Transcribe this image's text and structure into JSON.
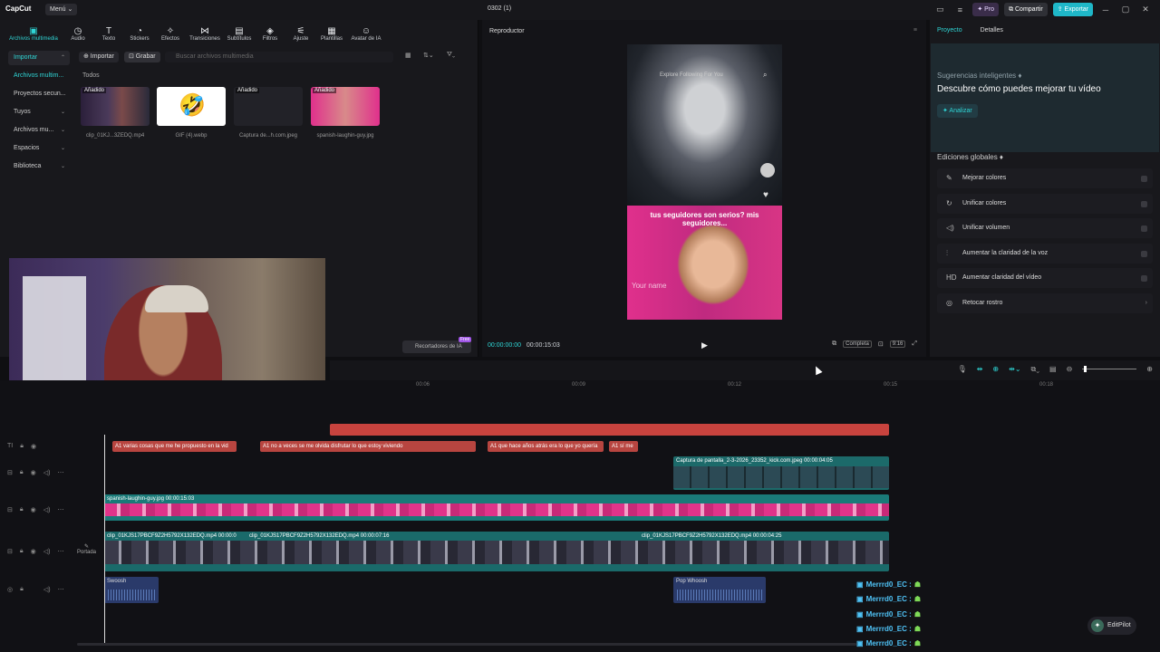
{
  "app": {
    "logo": "CapCut",
    "menu": "Menú ⌄",
    "project_title": "0302 (1)"
  },
  "topbar": {
    "pro": "✦ Pro",
    "share": "⧉ Compartir",
    "export": "⇪ Exportar",
    "min": "─",
    "max": "▢",
    "close": "✕"
  },
  "tools": [
    {
      "label": "Archivos multimedia",
      "icon": "▣"
    },
    {
      "label": "Audio",
      "icon": "◷"
    },
    {
      "label": "Texto",
      "icon": "T"
    },
    {
      "label": "Stickers",
      "icon": "◔"
    },
    {
      "label": "Efectos",
      "icon": "✧"
    },
    {
      "label": "Transiciones",
      "icon": "⋈"
    },
    {
      "label": "Subtítulos",
      "icon": "▤"
    },
    {
      "label": "Filtros",
      "icon": "◈"
    },
    {
      "label": "Ajuste",
      "icon": "⚟"
    },
    {
      "label": "Plantillas",
      "icon": "▦"
    },
    {
      "label": "Avatar de IA",
      "icon": "☺"
    }
  ],
  "sidenav": [
    {
      "label": "Importar"
    },
    {
      "label": "Archivos multim..."
    },
    {
      "label": "Proyectos secun..."
    },
    {
      "label": "Tuyos"
    },
    {
      "label": "Archivos mu..."
    },
    {
      "label": "Espacios"
    },
    {
      "label": "Biblioteca"
    }
  ],
  "media": {
    "import": "⊕ Importar",
    "record": "⊡ Grabar",
    "search_placeholder": "Buscar archivos multimedia",
    "filter": "Todos",
    "items": [
      {
        "tag": "Añadido",
        "name": "clip_01KJ...3ZEDQ.mp4"
      },
      {
        "tag": "",
        "name": "GIF (4).webp"
      },
      {
        "tag": "Añadido",
        "name": "Captura de...h.com.jpeg"
      },
      {
        "tag": "Añadido",
        "name": "spanish-laughin-guy.jpg"
      }
    ],
    "ai_cutouts": "Recortadores de IA",
    "free": "Free"
  },
  "player": {
    "title": "Reproductor",
    "current_time": "00:00:00:00",
    "total_time": "00:00:15:03",
    "full": "Completa",
    "ratio": "9:16",
    "video_nav": "Explore   Following   For You",
    "video_caption": "tus seguidores son serios? mis seguidores...",
    "video_overlay": "Your name"
  },
  "right": {
    "tab_project": "Proyecto",
    "tab_details": "Detalles",
    "suggest_sub": "Sugerencias inteligentes ♦",
    "suggest_main": "Descubre cómo puedes mejorar tu vídeo",
    "analyze": "✦ Analizar",
    "global_title": "Ediciones globales ♦",
    "edits": [
      {
        "label": "Mejorar colores",
        "icon": "✎"
      },
      {
        "label": "Unificar colores",
        "icon": "↻"
      },
      {
        "label": "Unificar volumen",
        "icon": "◁)"
      },
      {
        "label": "Aumentar la claridad de la voz",
        "icon": "⫶"
      },
      {
        "label": "Aumentar claridad del vídeo",
        "icon": "HD"
      },
      {
        "label": "Retocar rostro",
        "icon": "◎"
      }
    ]
  },
  "timeline": {
    "ruler": [
      "00:06",
      "00:09",
      "00:12",
      "00:15",
      "00:18"
    ],
    "subs": [
      "A1 varias cosas que me he propuesto en la vid",
      "A1 no a veces se me olvida disfrutar lo que estoy viviendo",
      "A1 que hace años atrás era lo que yo quería",
      "A1 sí me"
    ],
    "screenshot_clip": "Captura de pantalla_2-3-2026_23352_kick.com.jpeg  00:00:04:05",
    "laugh_clip": "spanish-laughin-guy.jpg  00:00:15:03",
    "main_clips": [
      "clip_01KJS17PBCF9Z2H5792X132EDQ.mp4  00:00:0",
      "clip_01KJS17PBCF9Z2H5792X132EDQ.mp4  00:00:07:16",
      "clip_01KJS17PBCF9Z2H5792X132EDQ.mp4  00:00:04:25"
    ],
    "cover": "Portada",
    "audio_1": "Swoosh",
    "audio_2": "Pop Whoosh"
  },
  "chat": [
    "Merrrd0_EC :",
    "Merrrd0_EC :",
    "Merrrd0_EC :",
    "Merrrd0_EC :",
    "Merrrd0_EC :"
  ],
  "editpilot": "EditPilot"
}
